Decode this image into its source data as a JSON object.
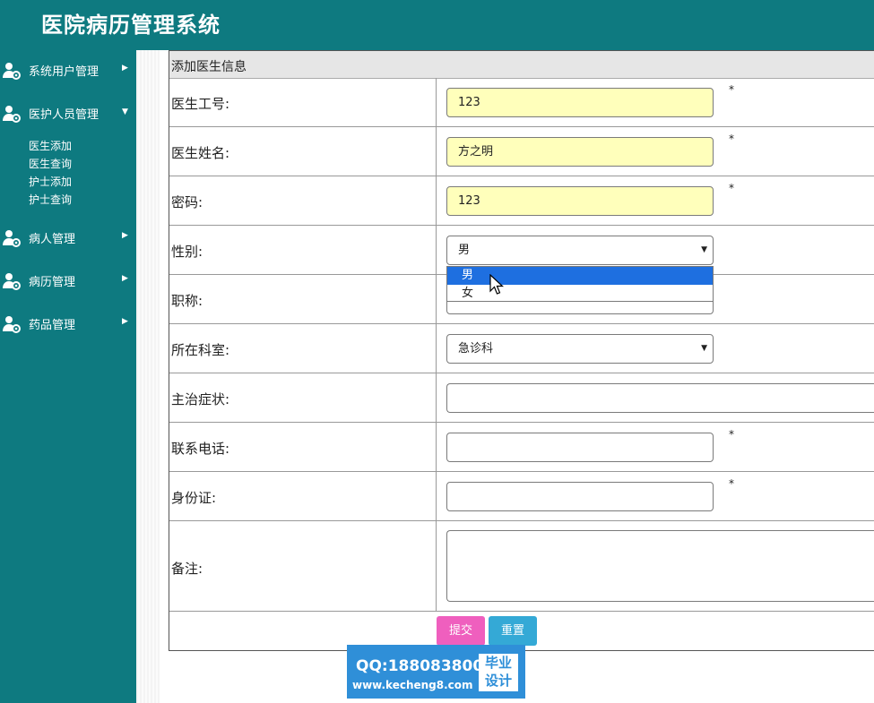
{
  "app": {
    "title": "医院病历管理系统",
    "accent": "#0e7a80"
  },
  "sidebar": {
    "items": [
      {
        "label": "系统用户管理",
        "expanded": false
      },
      {
        "label": "医护人员管理",
        "expanded": true,
        "children": [
          "医生添加",
          "医生查询",
          "护士添加",
          "护士查询"
        ]
      },
      {
        "label": "病人管理",
        "expanded": false
      },
      {
        "label": "病历管理",
        "expanded": false
      },
      {
        "label": "药品管理",
        "expanded": false
      }
    ],
    "arrow_right": "▶",
    "arrow_down": "▼",
    "icon": "user-gear-icon"
  },
  "form": {
    "title": "添加医生信息",
    "required_mark": "*",
    "fields": {
      "doctor_id": {
        "label": "医生工号:",
        "value": "123"
      },
      "doctor_name": {
        "label": "医生姓名:",
        "value": "方之明"
      },
      "password": {
        "label": "密码:",
        "value": "123"
      },
      "gender": {
        "label": "性别:",
        "value": "男",
        "options": [
          "男",
          "女"
        ],
        "highlighted": "男"
      },
      "title": {
        "label": "职称:",
        "value": ""
      },
      "department": {
        "label": "所在科室:",
        "value": "急诊科"
      },
      "specialty": {
        "label": "主治症状:",
        "value": ""
      },
      "phone": {
        "label": "联系电话:",
        "value": ""
      },
      "id_card": {
        "label": "身份证:",
        "value": ""
      },
      "remark": {
        "label": "备注:",
        "value": ""
      }
    },
    "buttons": {
      "submit": "提交",
      "reset": "重置"
    },
    "select_caret": "▼"
  },
  "watermark": {
    "qq": "QQ:188083800",
    "url": "www.kecheng8.com",
    "badge_line1": "毕业",
    "badge_line2": "设计"
  }
}
